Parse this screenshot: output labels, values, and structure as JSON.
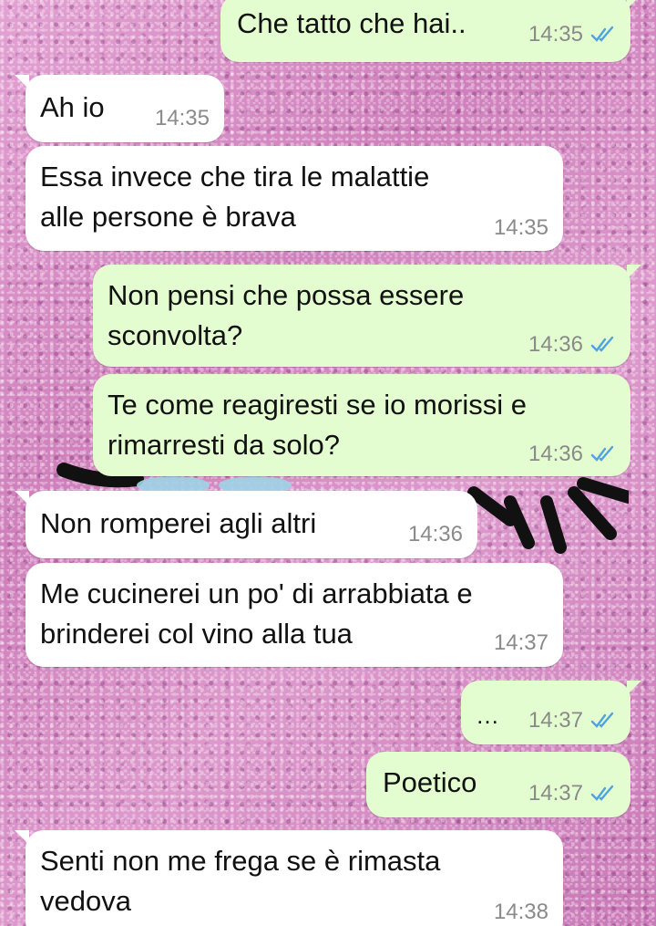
{
  "chat": {
    "messages": [
      {
        "direction": "out",
        "lines": [
          "Che tatto che hai.."
        ],
        "time": "14:35",
        "read": true
      },
      {
        "direction": "in",
        "lines": [
          "Ah io"
        ],
        "time": "14:35"
      },
      {
        "direction": "in",
        "lines": [
          "Essa invece che tira le malattie",
          "alle persone è brava"
        ],
        "time": "14:35"
      },
      {
        "direction": "out",
        "lines": [
          "Non pensi che possa essere",
          "sconvolta?"
        ],
        "time": "14:36",
        "read": true
      },
      {
        "direction": "out",
        "lines": [
          "Te come reagiresti se io morissi e",
          "rimarresti da solo?"
        ],
        "time": "14:36",
        "read": true
      },
      {
        "direction": "in",
        "lines": [
          "Non romperei agli altri"
        ],
        "time": "14:36"
      },
      {
        "direction": "in",
        "lines": [
          "Me cucinerei un po' di arrabbiata e",
          "brinderei col vino alla tua"
        ],
        "time": "14:37"
      },
      {
        "direction": "out",
        "lines": [
          "…"
        ],
        "time": "14:37",
        "read": true
      },
      {
        "direction": "out",
        "lines": [
          "Poetico"
        ],
        "time": "14:37",
        "read": true
      },
      {
        "direction": "in",
        "lines": [
          "Senti non me frega se è rimasta",
          "vedova"
        ],
        "time": "14:38"
      }
    ]
  },
  "theme": {
    "incoming_bubble": "#ffffff",
    "outgoing_bubble": "#e4fdd0",
    "read_tick_color": "#4fa3e0",
    "wallpaper": "#d98cc4",
    "read_icon": "double-check-icon"
  }
}
